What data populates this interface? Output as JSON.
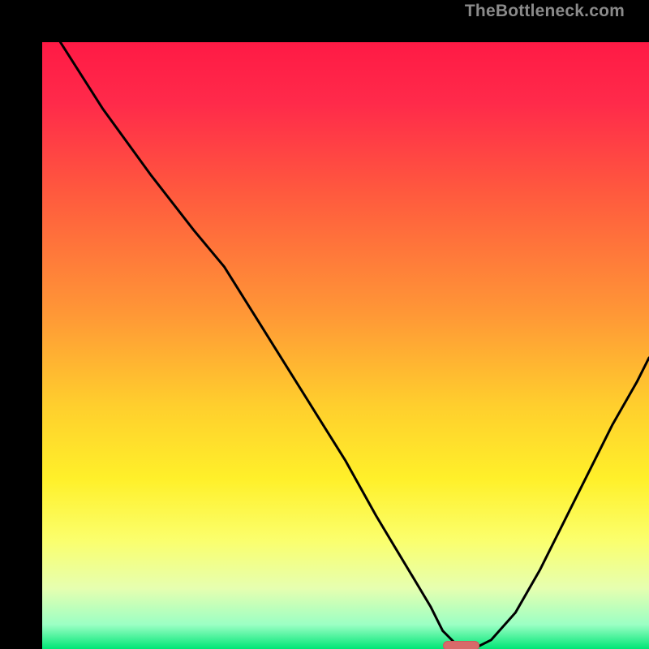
{
  "watermark": {
    "text": "TheBottleneck.com"
  },
  "colors": {
    "gradient_stops": [
      {
        "pct": 0,
        "color": "#ff1a45"
      },
      {
        "pct": 10,
        "color": "#ff2a4a"
      },
      {
        "pct": 25,
        "color": "#ff5a3e"
      },
      {
        "pct": 45,
        "color": "#ff9836"
      },
      {
        "pct": 60,
        "color": "#ffcf2d"
      },
      {
        "pct": 72,
        "color": "#fff02a"
      },
      {
        "pct": 82,
        "color": "#fbff6c"
      },
      {
        "pct": 90,
        "color": "#e6ffb0"
      },
      {
        "pct": 96,
        "color": "#9bffc4"
      },
      {
        "pct": 100,
        "color": "#00e676"
      }
    ],
    "curve": "#000000",
    "marker_fill": "#d86a6a",
    "marker_stroke": "#c95c5c"
  },
  "chart_data": {
    "type": "line",
    "title": "",
    "xlabel": "",
    "ylabel": "",
    "xlim": [
      0,
      100
    ],
    "ylim": [
      0,
      100
    ],
    "note": "Values are estimated from pixel positions; y=0 is bottom (green), y=100 is top (red). Curve depicts bottleneck mismatch percentage vs some x parameter; minimum near x≈69.",
    "series": [
      {
        "name": "bottleneck-curve",
        "x": [
          3,
          10,
          18,
          25,
          30,
          35,
          40,
          45,
          50,
          55,
          58,
          61,
          64,
          66,
          68,
          70,
          72,
          74,
          78,
          82,
          86,
          90,
          94,
          98,
          100
        ],
        "y": [
          100,
          89,
          78,
          69,
          63,
          55,
          47,
          39,
          31,
          22,
          17,
          12,
          7,
          3,
          1,
          0.5,
          0.5,
          1.5,
          6,
          13,
          21,
          29,
          37,
          44,
          48
        ]
      }
    ],
    "marker": {
      "x": 69,
      "y": 0.5,
      "width_x_units": 6,
      "height_y_units": 1.6
    }
  }
}
